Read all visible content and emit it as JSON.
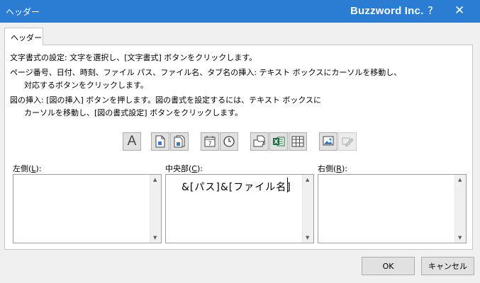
{
  "window": {
    "title": "ヘッダー",
    "brand": "Buzzword Inc.",
    "help": "?",
    "close": "✕"
  },
  "tab": {
    "label": "ヘッダー"
  },
  "instructions": [
    "文字書式の設定: 文字を選択し、[文字書式] ボタンをクリックします。",
    "ページ番号、日付、時刻、ファイル パス、ファイル名、タブ名の挿入: テキスト ボックスにカーソルを移動し、",
    "対応するボタンをクリックします。",
    "図の挿入: [図の挿入] ボタンを押します。図の書式を設定するには、テキスト ボックスに",
    "カーソルを移動し、[図の書式設定] ボタンをクリックします。"
  ],
  "toolbar": [
    {
      "icon": "format-text-icon"
    },
    {
      "icon": "insert-page-number-icon"
    },
    {
      "icon": "insert-number-of-pages-icon"
    },
    {
      "icon": "insert-date-icon"
    },
    {
      "icon": "insert-time-icon"
    },
    {
      "icon": "insert-file-path-icon"
    },
    {
      "icon": "insert-file-name-icon"
    },
    {
      "icon": "insert-sheet-name-icon"
    },
    {
      "icon": "insert-picture-icon"
    },
    {
      "icon": "format-picture-icon",
      "disabled": true
    }
  ],
  "sections": {
    "left": {
      "label": "左側",
      "key": "L",
      "value": ""
    },
    "center": {
      "label": "中央部",
      "key": "C",
      "value": "&[パス]&[ファイル名]"
    },
    "right": {
      "label": "右側",
      "key": "R",
      "value": ""
    }
  },
  "buttons": {
    "ok": "OK",
    "cancel": "キャンセル"
  },
  "colors": {
    "titlebar": "#2b7cd3",
    "excel_green": "#1e7145"
  }
}
